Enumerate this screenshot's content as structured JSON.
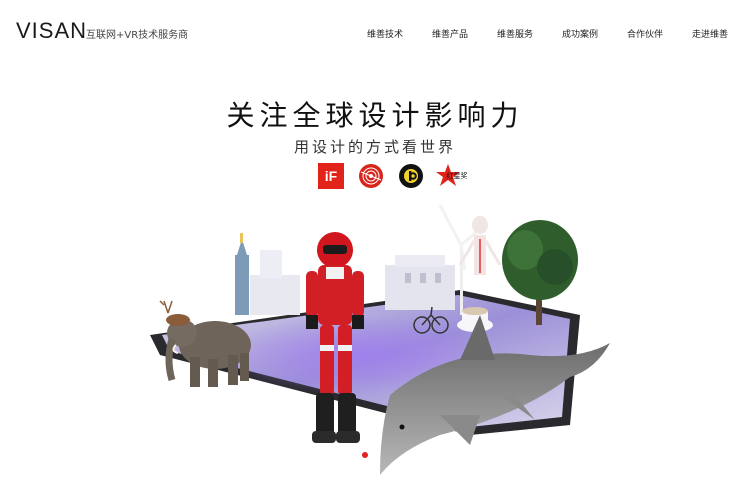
{
  "header": {
    "logo": "VISAN",
    "tagline": "互联网+VR技术服务商",
    "nav": [
      {
        "label": "维善技术"
      },
      {
        "label": "维善产品"
      },
      {
        "label": "维善服务"
      },
      {
        "label": "成功案例"
      },
      {
        "label": "合作伙伴"
      },
      {
        "label": "走进维善"
      }
    ]
  },
  "hero": {
    "headline": "关注全球设计影响力",
    "subline": "用设计的方式看世界",
    "awards": [
      {
        "name": "if-award-icon",
        "text": "iF"
      },
      {
        "name": "red-dot-award-icon",
        "text": ""
      },
      {
        "name": "good-design-award-icon",
        "text": ""
      },
      {
        "name": "red-star-award-icon",
        "text": "红星奖"
      }
    ]
  },
  "carousel": {
    "active_color": "#e22020"
  },
  "colors": {
    "accent": "#e22020",
    "text": "#222222"
  }
}
